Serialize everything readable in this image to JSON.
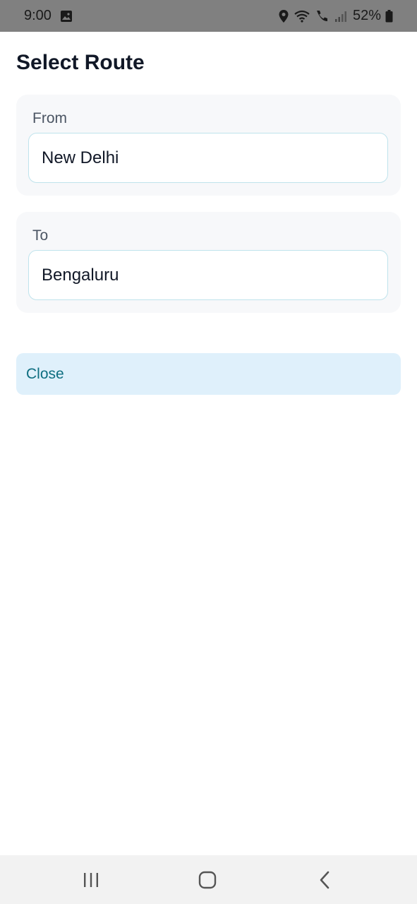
{
  "status_bar": {
    "time": "9:00",
    "battery": "52%",
    "icons": [
      "image-icon",
      "location-icon",
      "wifi-icon",
      "call-icon",
      "signal-icon",
      "battery-icon"
    ]
  },
  "page": {
    "title": "Select Route"
  },
  "from": {
    "label": "From",
    "value": "New Delhi"
  },
  "to": {
    "label": "To",
    "value": "Bengaluru"
  },
  "actions": {
    "close_label": "Close"
  },
  "nav_bar": {
    "icons": [
      "recent-apps-icon",
      "home-icon",
      "back-icon"
    ]
  },
  "colors": {
    "accent": "#0e6e80",
    "button_bg": "#dff0fb",
    "input_border": "#bfe3ec",
    "status_bar_bg": "#808080"
  }
}
